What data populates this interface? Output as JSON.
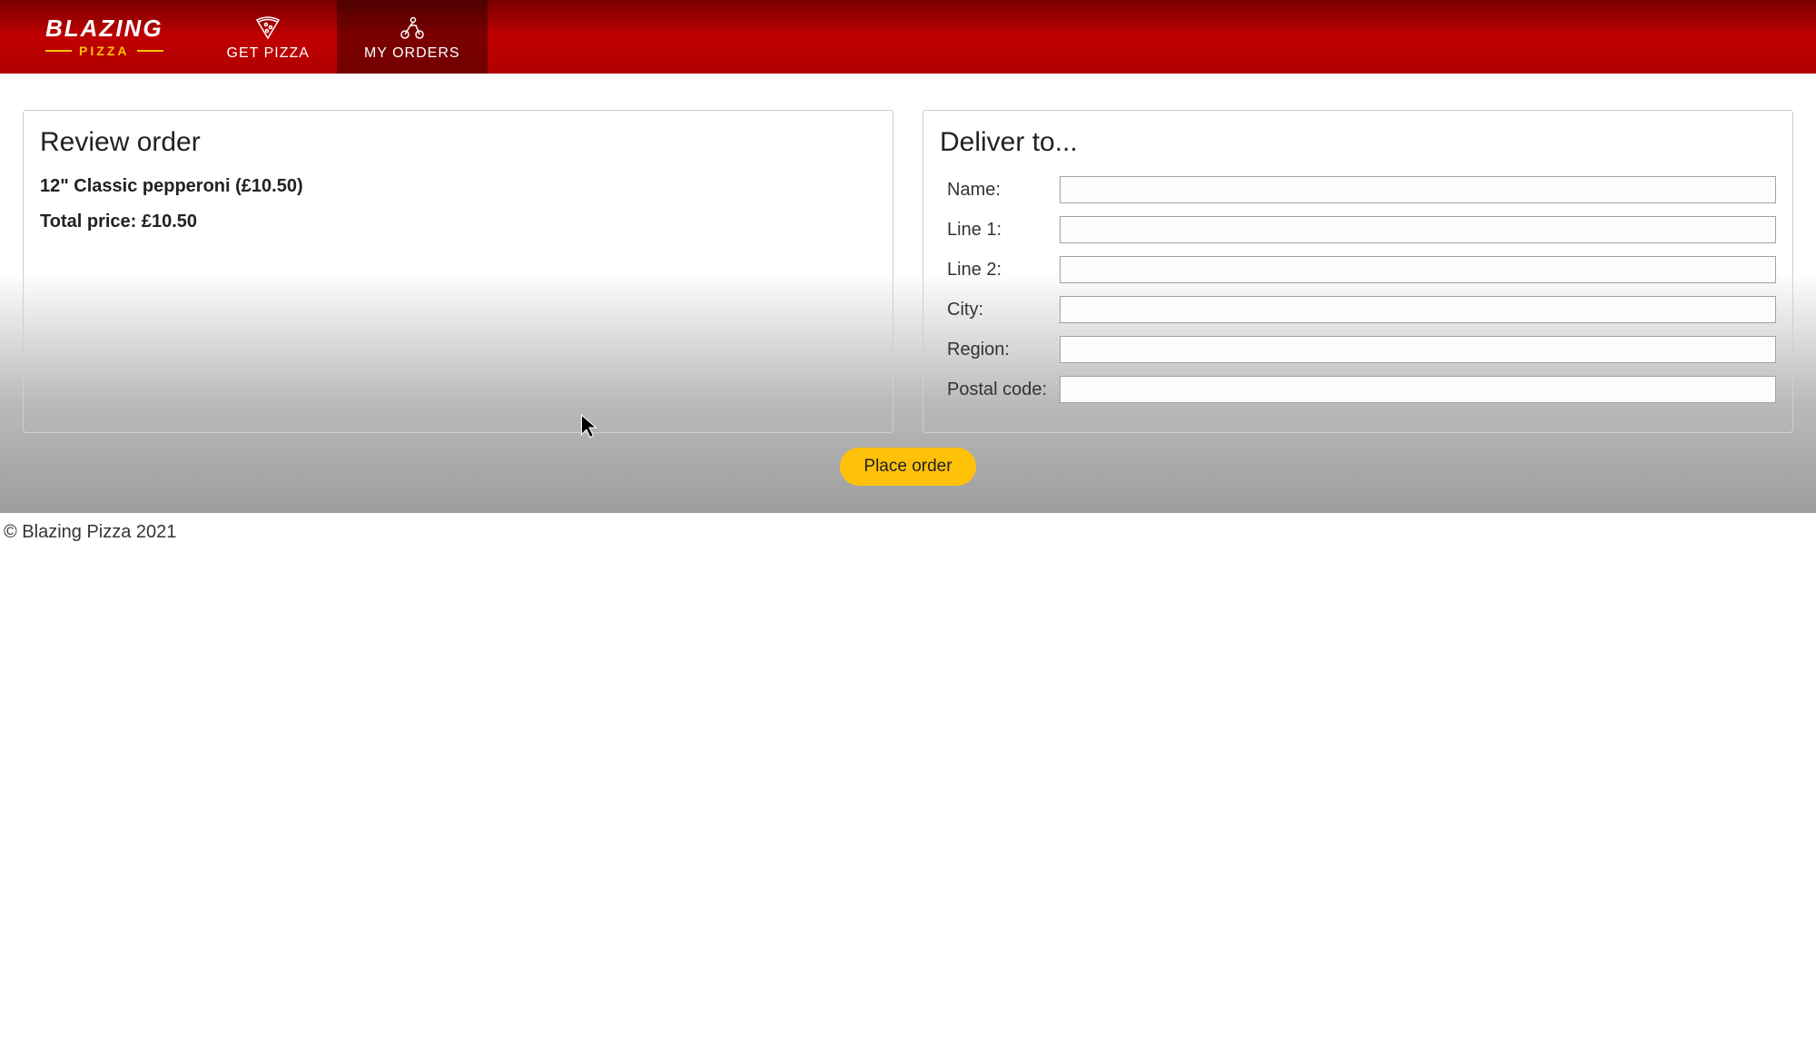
{
  "brand": {
    "top": "BLAZING",
    "bottom": "PIZZA"
  },
  "nav": {
    "getPizza": "GET PIZZA",
    "myOrders": "MY ORDERS"
  },
  "review": {
    "title": "Review order",
    "items": [
      {
        "text": "12\" Classic pepperoni (£10.50)"
      }
    ],
    "totalLabel": "Total price:",
    "totalValue": "£10.50"
  },
  "delivery": {
    "title": "Deliver to...",
    "fields": {
      "name": {
        "label": "Name:",
        "value": ""
      },
      "line1": {
        "label": "Line 1:",
        "value": ""
      },
      "line2": {
        "label": "Line 2:",
        "value": ""
      },
      "city": {
        "label": "City:",
        "value": ""
      },
      "region": {
        "label": "Region:",
        "value": ""
      },
      "postal": {
        "label": "Postal code:",
        "value": ""
      }
    }
  },
  "actions": {
    "placeOrder": "Place order"
  },
  "footer": "© Blazing Pizza 2021"
}
